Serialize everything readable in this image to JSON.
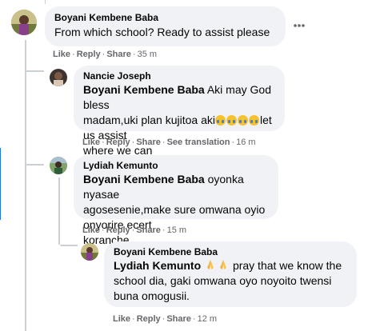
{
  "comments": [
    {
      "author": "Boyani Kembene Baba",
      "text": "From which school? Ready to assist please",
      "actions": {
        "like": "Like",
        "reply": "Reply",
        "share": "Share",
        "time": "35 m"
      }
    },
    {
      "author": "Nancie Joseph",
      "mention": "Boyani Kembene Baba",
      "text1": "Aki may God bless",
      "text2": "madam,uki plan kujitoa aki",
      "text3": "let us assist",
      "text4": "where we can",
      "actions": {
        "like": "Like",
        "reply": "Reply",
        "share": "Share",
        "translate": "See translation",
        "time": "16 m"
      }
    },
    {
      "author": "Lydiah Kemunto",
      "mention": "Boyani Kembene Baba",
      "text1": "oyonka nyasae",
      "text2": "agosesenie,make sure omwana oyio onyorire ecert",
      "text3": "koranche",
      "actions": {
        "like": "Like",
        "reply": "Reply",
        "share": "Share",
        "time": "15 m"
      }
    },
    {
      "author": "Boyani Kembene Baba",
      "mention": "Lydiah Kemunto",
      "text1": "pray that we know the",
      "text2": "school dia, gaki omwana oyo noyoito twensi",
      "text3": "buna omogusii.",
      "actions": {
        "like": "Like",
        "reply": "Reply",
        "share": "Share",
        "time": "12 m"
      }
    }
  ],
  "icons": {
    "more": "more-horizontal-icon",
    "crying": "crying-face-emoji",
    "pray": "folded-hands-emoji"
  },
  "colors": {
    "bubble": "#f0f2f5",
    "meta": "#65676b",
    "thread_line": "#ccd0d5"
  }
}
